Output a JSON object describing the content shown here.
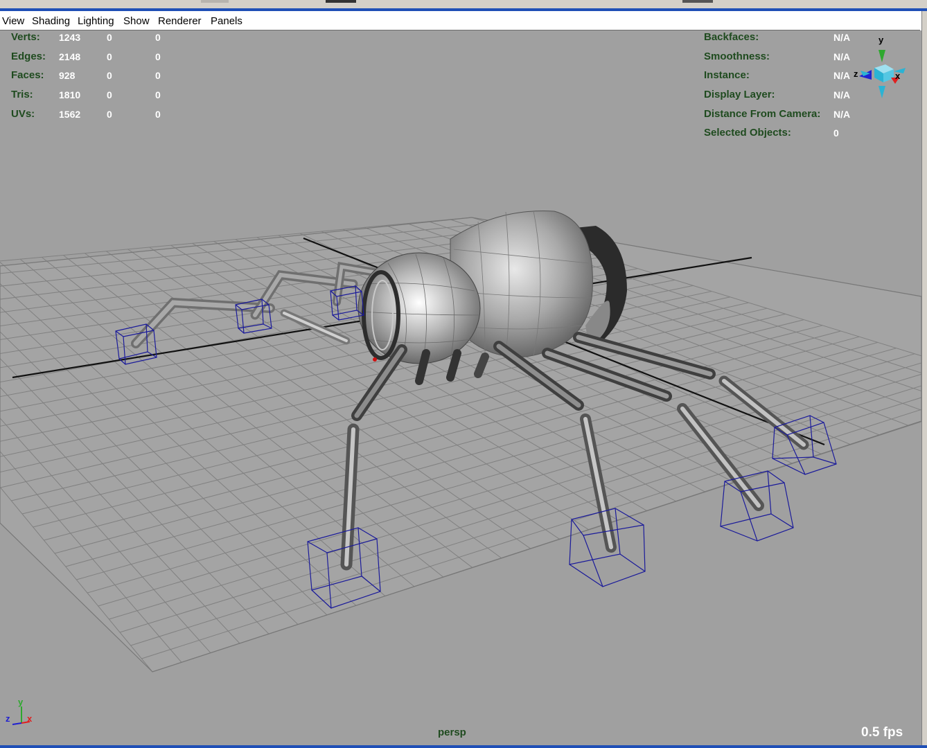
{
  "menu": [
    "View",
    "Shading",
    "Lighting",
    "Show",
    "Renderer",
    "Panels"
  ],
  "poly_stats": [
    {
      "label": "Verts:",
      "values": [
        "1243",
        "0",
        "0"
      ]
    },
    {
      "label": "Edges:",
      "values": [
        "2148",
        "0",
        "0"
      ]
    },
    {
      "label": "Faces:",
      "values": [
        "928",
        "0",
        "0"
      ]
    },
    {
      "label": "Tris:",
      "values": [
        "1810",
        "0",
        "0"
      ]
    },
    {
      "label": "UVs:",
      "values": [
        "1562",
        "0",
        "0"
      ]
    }
  ],
  "object_info": [
    {
      "label": "Backfaces:",
      "value": "N/A"
    },
    {
      "label": "Smoothness:",
      "value": "N/A"
    },
    {
      "label": "Instance:",
      "value": "N/A"
    },
    {
      "label": "Display Layer:",
      "value": "N/A"
    },
    {
      "label": "Distance From Camera:",
      "value": "N/A"
    },
    {
      "label": "Selected Objects:",
      "value": "0"
    }
  ],
  "view_cube_axes": {
    "y": "y",
    "z": "z",
    "x": "x"
  },
  "origin_axes": {
    "y": "y",
    "z": "z",
    "x": "x"
  },
  "camera_name": "persp",
  "fps": "0.5 fps",
  "colors": {
    "viewport": "#a0a0a0",
    "grid": "#7f7f7f",
    "hud_label": "#1f4b1f",
    "hud_value": "#ffffff",
    "cube_outline": "#1a1a9a",
    "axis_x": "#e02020",
    "axis_y": "#2ea82e",
    "axis_z": "#2020d0"
  }
}
